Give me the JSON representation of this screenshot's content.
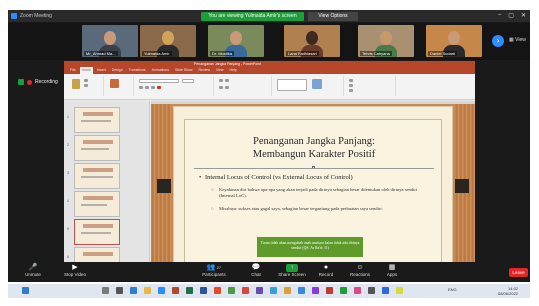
{
  "window": {
    "app_title": "Zoom Meeting",
    "viewing_banner": "You are viewing Yulmaida Amir's screen",
    "view_options": "View Options",
    "view_label": "View"
  },
  "participants": [
    {
      "name": "Mr_Ahmad Ma..."
    },
    {
      "name": "Yulmaida Amir"
    },
    {
      "name": "Dr. Mustika"
    },
    {
      "name": "Lana Fadhlasari"
    },
    {
      "name": "Tehris Cahyana"
    },
    {
      "name": "Daniel Sudarti"
    }
  ],
  "recording_label": "Recording",
  "powerpoint": {
    "doc_title": "Penanganan Jangka Panjang - PowerPoint",
    "tabs": [
      "File",
      "Home",
      "Insert",
      "Design",
      "Transitions",
      "Animations",
      "Slide Show",
      "Review",
      "View",
      "Help"
    ],
    "active_tab": "Home",
    "slide_numbers": [
      "1",
      "2",
      "3",
      "4",
      "5",
      "6"
    ]
  },
  "slide": {
    "title_line1": "Penanganan Jangka Panjang:",
    "title_line2": "Membangun Karakter Positif",
    "bullet": "Internal Locus of Control (vs External Locus of Control)",
    "sub1": "Keyakinan diri bahwa apa-apa yang akan terjadi pada dirinya sebagian besar ditentukan oleh dirinya sendiri (Internal LoC).",
    "sub2": "Misalnya: sukses atau gagal saya, sebagian besar tergantung pada perbuatan saya sendiri.",
    "note": "Tiram tidak akan mengubah anak mutiara kalau tidak ada dirinya sendiri (QS. Ar Ra'd: 11)"
  },
  "toolbar": {
    "unmute": "Unmute",
    "stop_video": "Stop Video",
    "participants": "Participants",
    "participants_count": "27",
    "chat": "Chat",
    "share_screen": "Share Screen",
    "record": "Record",
    "reactions": "Reactions",
    "apps": "Apps",
    "leave": "Leave"
  },
  "taskbar": {
    "tray_text": "ENG",
    "time": "14:02",
    "date": "08/06/2022"
  }
}
